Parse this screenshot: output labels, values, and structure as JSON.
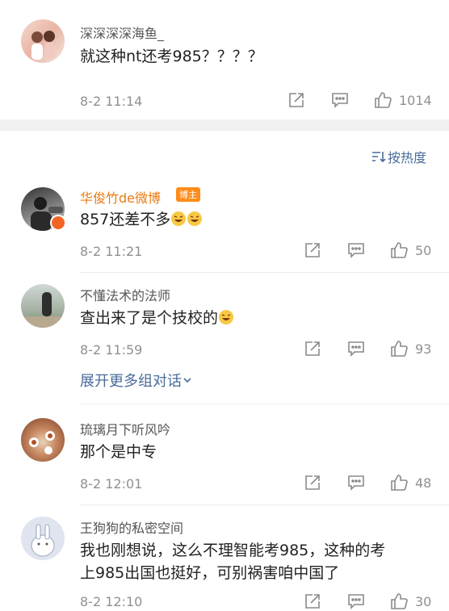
{
  "post": {
    "user": "深深深深海鱼_",
    "text": "就这种nt还考985？？？？",
    "time": "8-2 11:14",
    "likes": "1014"
  },
  "sort_label": "按热度",
  "comments": [
    {
      "user": "华俊竹de微博",
      "badge": "博主",
      "text": "857还差不多",
      "time": "8-2 11:21",
      "likes": "50"
    },
    {
      "user": "不懂法术的法师",
      "text": "查出来了是个技校的",
      "time": "8-2 11:59",
      "likes": "93"
    },
    {
      "user": "琉璃月下听风吟",
      "text": "那个是中专",
      "time": "8-2 12:01",
      "likes": "48"
    },
    {
      "user": "王狗狗的私密空间",
      "text_line1": "我也刚想说，这么不理智能考985，这种的考",
      "text_line2": "上985出国也挺好，可别祸害咱中国了",
      "time": "8-2 12:10",
      "likes": "30"
    }
  ],
  "expand_label": "展开更多组对话",
  "colors": {
    "link": "#4a6b9a",
    "vip": "#ea7a10",
    "meta": "#909090"
  },
  "icons": [
    "share-icon",
    "comment-icon",
    "like-icon",
    "sort-icon",
    "chevron-down-icon",
    "laugh-emoji"
  ]
}
